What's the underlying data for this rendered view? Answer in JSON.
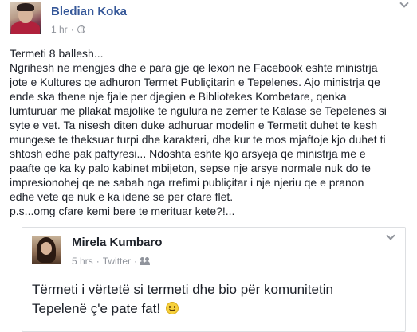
{
  "post": {
    "author": "Bledian Koka",
    "time": "1 hr",
    "separator": "·",
    "text_lines": [
      "Termeti 8 ballesh...",
      "Ngrihesh ne mengjes dhe e para gje qe lexon ne Facebook eshte ministrja",
      "jote e Kultures qe adhuron Termet Publiçitarin e Tepelenes. Ajo ministrja qe",
      "ende ska thene nje fjale per djegien e Bibliotekes Kombetare, qenka",
      "lumturuar me pllakat majolike te ngulura ne zemer te Kalase se Tepelenes si",
      "syte e vet. Ta nisesh diten duke adhuruar modelin e Termetit duhet te kesh",
      "mungese te theksuar turpi dhe karakteri, dhe kur te mos mjaftoje kjo duhet ti",
      "shtosh edhe pak paftyresi... Ndoshta eshte kjo arsyeja qe ministrja me e",
      "paafte qe ka ky palo kabinet mbijeton, sepse nje arsye normale nuk do te",
      "impresionohej qe ne sabah nga rrefimi publiçitar i nje njeriu qe e pranon",
      "edhe vete qe nuk e ka idene se per cfare flet.",
      "p.s...omg cfare kemi bere te merituar kete?!..."
    ]
  },
  "shared": {
    "author": "Mirela Kumbaro",
    "time": "5 hrs",
    "separator": "·",
    "via": "Twitter",
    "text_line1": "Tërmeti i vërtetë si termeti dhe bio për komunitetin",
    "text_line2": "Tepelenë ç'e pate fat!"
  },
  "icons": {
    "privacy": "globe-icon",
    "audience": "friends-icon",
    "menu": "chevron-down-icon",
    "emoji": "smiley-icon"
  },
  "colors": {
    "link": "#365899",
    "meta": "#90949c",
    "text": "#1d2129",
    "border": "#dddfe2"
  }
}
